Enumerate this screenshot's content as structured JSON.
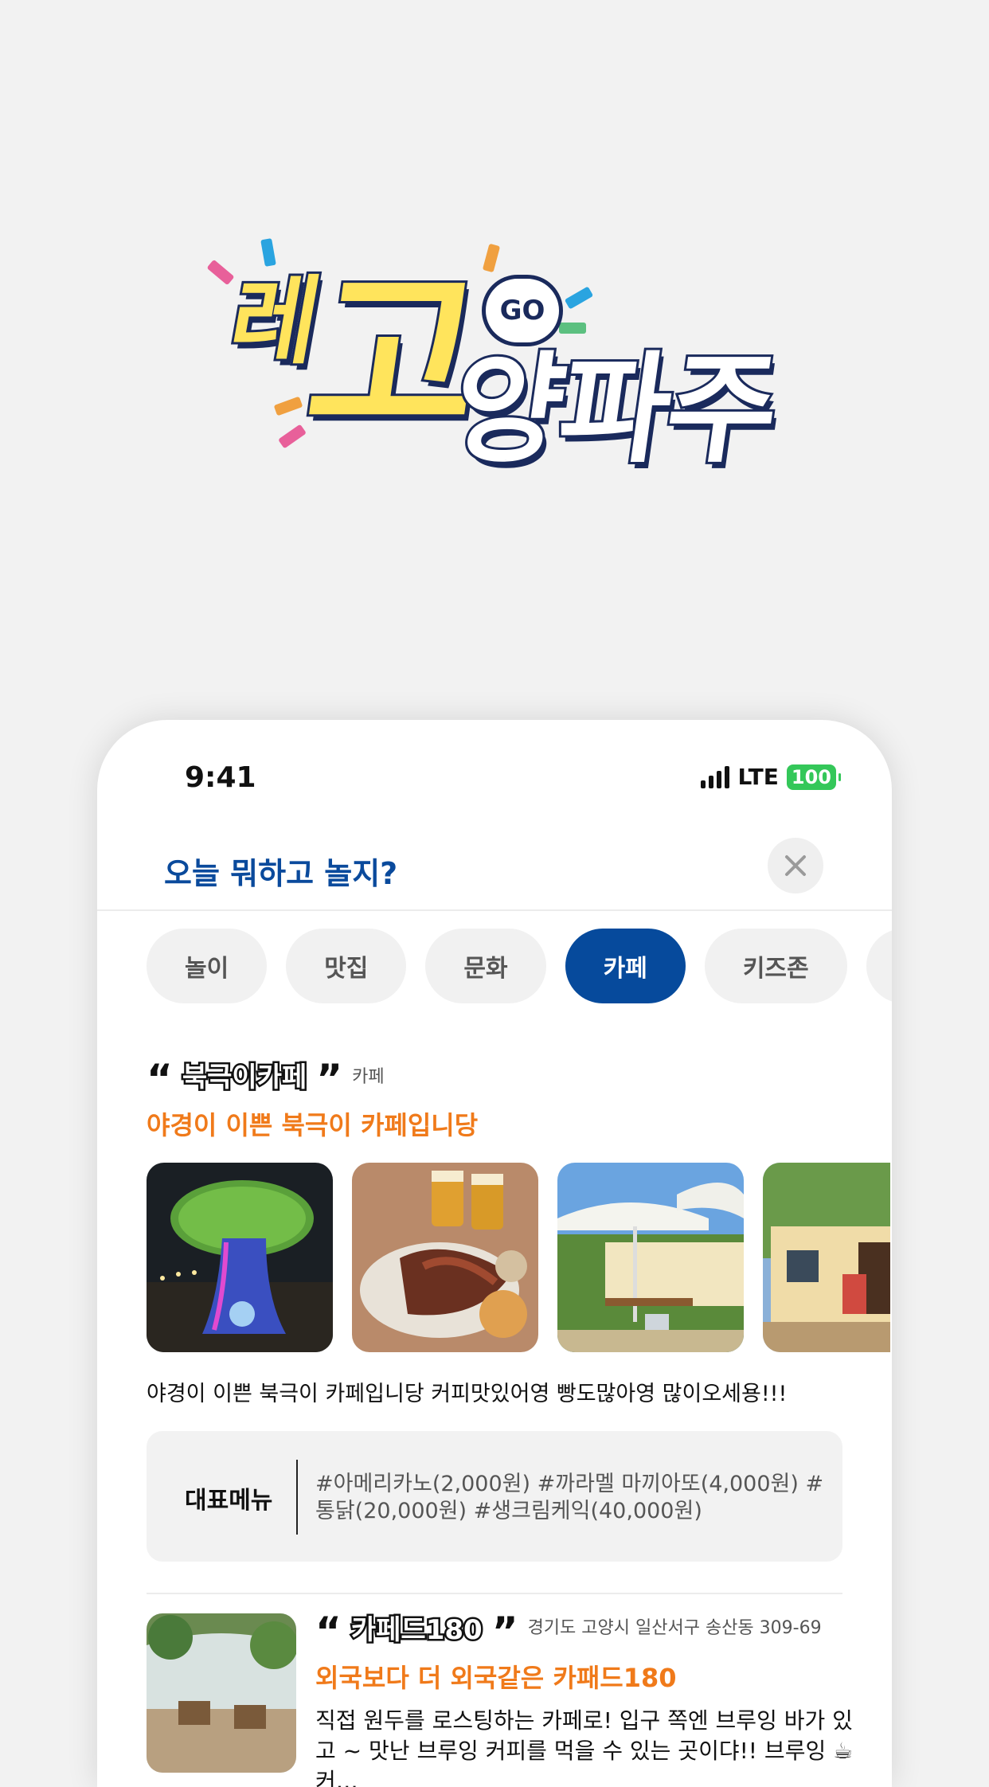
{
  "logo": {
    "part1": "레",
    "part2": "고",
    "part3": "양파주",
    "bubble": "GO"
  },
  "status_bar": {
    "time": "9:41",
    "network": "LTE",
    "battery": "100"
  },
  "header": {
    "title": "오늘 뭐하고 놀지?"
  },
  "tabs": [
    {
      "label": "놀이"
    },
    {
      "label": "맛집"
    },
    {
      "label": "문화"
    },
    {
      "label": "카페",
      "active": true
    },
    {
      "label": "키즈존"
    },
    {
      "label": ""
    }
  ],
  "featured": {
    "name": "북극이카페",
    "category": "카페",
    "headline": "야경이 이쁜 북극이 카페입니당",
    "description": "야경이 이쁜 북극이 카페입니당 커피맛있어영 빵도많아영 많이오세용!!!",
    "menu_label": "대표메뉴",
    "menu_text": "#아메리카노(2,000원) #까라멜 마끼아또(4,000원) #통닭(20,000원) #생크림케익(40,000원)",
    "photos": [
      "night-tree-photo",
      "grilled-ribs-beer-photo",
      "patio-umbrella-photo",
      "cottage-exterior-photo"
    ]
  },
  "second_item": {
    "name": "카페드180",
    "address": "경기도 고양시 일산서구 송산동 309-69",
    "headline": "외국보다 더 외국같은 카패드180",
    "description": "직접 원두를 로스팅하는 카페로! 입구 쪽엔 브루잉 바가 있고 ~ 맛난 브루잉 커피를 먹을 수 있는 곳이댜!! 브루잉 ☕커…"
  },
  "colors": {
    "brand_blue": "#064a9c",
    "accent_orange": "#f07a1a",
    "battery_green": "#34c759"
  }
}
